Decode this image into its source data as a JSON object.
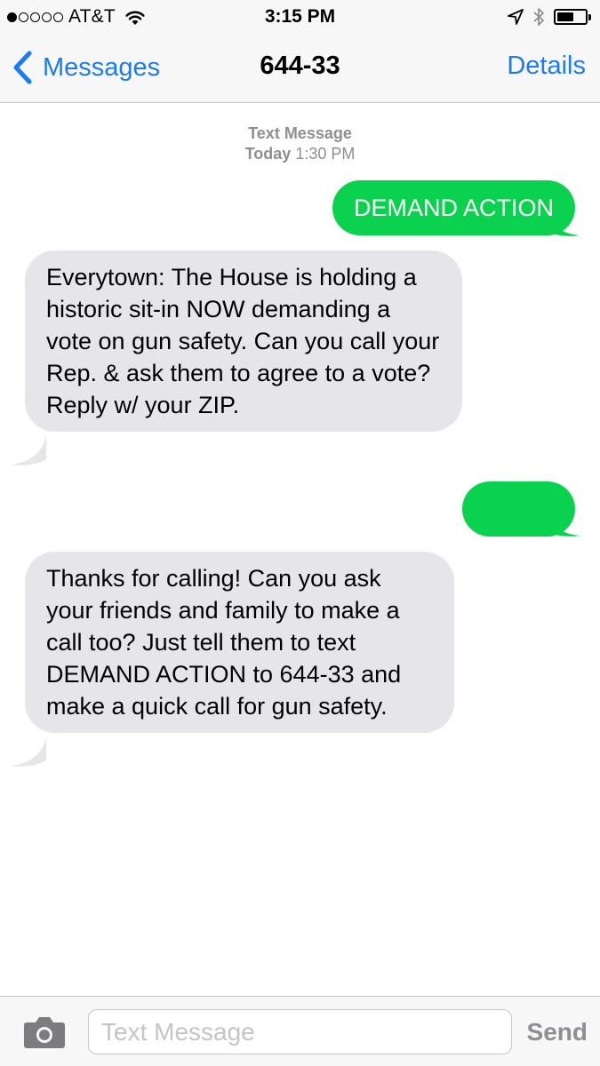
{
  "status_bar": {
    "carrier": "AT&T",
    "time": "3:15 PM",
    "signal_dots_filled": 1,
    "signal_dots_total": 5,
    "battery_level": 0.6
  },
  "nav": {
    "back_label": "Messages",
    "title": "644-33",
    "details_label": "Details"
  },
  "conversation": {
    "timestamp": {
      "line1": "Text Message",
      "day": "Today",
      "time": "1:30 PM"
    },
    "messages": [
      {
        "direction": "outgoing",
        "text": "DEMAND ACTION"
      },
      {
        "direction": "incoming",
        "text": "Everytown: The House is holding a historic sit-in NOW demanding a vote on gun safety. Can you call your Rep. & ask them to agree to a vote? Reply w/ your ZIP."
      },
      {
        "direction": "outgoing",
        "text": ""
      },
      {
        "direction": "incoming",
        "text": "Thanks for calling! Can you ask your friends and family to make a call too? Just tell them to text DEMAND ACTION to 644-33 and make a quick call for gun safety."
      }
    ]
  },
  "input_bar": {
    "placeholder": "Text Message",
    "send_label": "Send"
  },
  "colors": {
    "accent": "#1a7cf5",
    "outgoing_bubble": "#0bd24e",
    "incoming_bubble": "#e5e5ea",
    "secondary_text": "#8e8e93"
  },
  "icons": {
    "back": "chevron-left-icon",
    "wifi": "wifi-icon",
    "location": "location-arrow-icon",
    "bluetooth": "bluetooth-icon",
    "battery": "battery-icon",
    "camera": "camera-icon"
  }
}
